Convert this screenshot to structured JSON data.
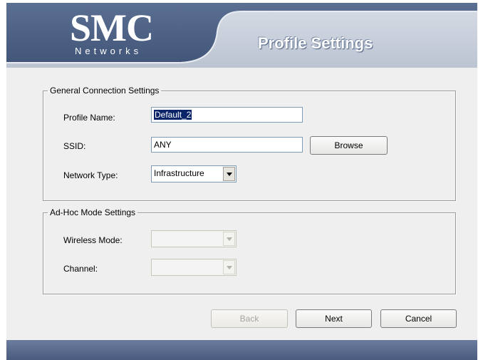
{
  "header": {
    "logo_main": "SMC",
    "logo_sub": "Networks",
    "title": "Profile Settings"
  },
  "general": {
    "legend": "General Connection Settings",
    "profile_name_label": "Profile Name:",
    "profile_name_value": "Default_2",
    "ssid_label": "SSID:",
    "ssid_value": "ANY",
    "browse_label": "Browse",
    "network_type_label": "Network Type:",
    "network_type_value": "Infrastructure"
  },
  "adhoc": {
    "legend": "Ad-Hoc Mode Settings",
    "wireless_mode_label": "Wireless Mode:",
    "wireless_mode_value": "",
    "channel_label": "Channel:",
    "channel_value": ""
  },
  "buttons": {
    "back": "Back",
    "next": "Next",
    "cancel": "Cancel"
  },
  "colors": {
    "banner_dark": "#4d6285",
    "banner_light": "#c9cfd9",
    "footer": "#5a6a8c"
  }
}
